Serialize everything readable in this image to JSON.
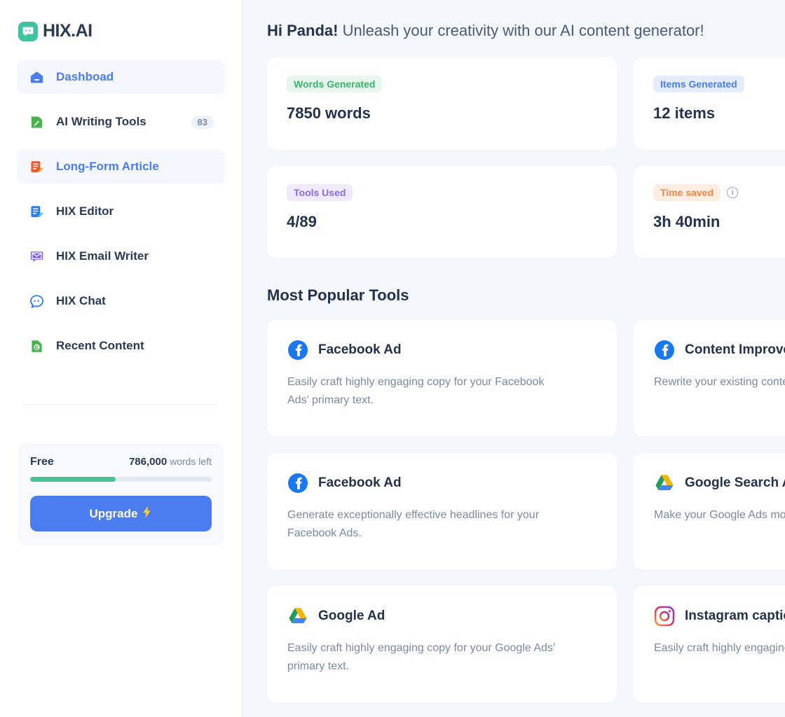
{
  "brand": {
    "name": "HIX.AI",
    "logo_icon": "chat-bubble-icon",
    "logo_color": "#3fc4a0"
  },
  "sidebar": {
    "items": [
      {
        "label": "Dashboad",
        "icon": "home-icon",
        "badge": "",
        "active": true
      },
      {
        "label": "AI Writing Tools",
        "icon": "magic-wand-doc-icon",
        "badge": "83",
        "active": false
      },
      {
        "label": "Long-Form Article",
        "icon": "article-pencil-icon",
        "badge": "",
        "active": true
      },
      {
        "label": "HIX Editor",
        "icon": "editor-doc-icon",
        "badge": "",
        "active": false
      },
      {
        "label": "HIX Email Writer",
        "icon": "email-icon",
        "badge": "",
        "active": false
      },
      {
        "label": "HIX Chat",
        "icon": "chat-icon",
        "badge": "",
        "active": false
      },
      {
        "label": "Recent Content",
        "icon": "recent-file-icon",
        "badge": "",
        "active": false
      }
    ],
    "plan": {
      "name": "Free",
      "quota_number": "786,000",
      "quota_suffix": " words left",
      "progress_percent": 47,
      "progress_color": "#46c494",
      "upgrade_label": "Upgrade",
      "upgrade_icon": "lightning-bolt-icon",
      "upgrade_color": "#4c7df0"
    }
  },
  "main": {
    "greeting_name": "Hi Panda!",
    "greeting_rest": " Unleash your creativity with our AI content generator!",
    "stats": [
      {
        "badge": "Words Generated",
        "badge_color": "#3bb26d",
        "badge_bg": "#e7f7ed",
        "value": "7850 words",
        "has_info": false
      },
      {
        "badge": "Items Generated",
        "badge_color": "#4c7df0",
        "badge_bg": "#e4ecfd",
        "value": "12 items",
        "has_info": false
      },
      {
        "badge": "Tools Used",
        "badge_color": "#8a6ce8",
        "badge_bg": "#efeafc",
        "value": "4/89",
        "has_info": false
      },
      {
        "badge": "Time saved",
        "badge_color": "#f3874a",
        "badge_bg": "#fdeee1",
        "value": "3h 40min",
        "has_info": true,
        "info_icon": "info-circle-icon"
      }
    ],
    "section_title": "Most Popular Tools",
    "tools": [
      {
        "name": "Facebook Ad",
        "icon": "facebook-icon",
        "desc": "Easily craft highly engaging copy for your Facebook Ads’ primary text."
      },
      {
        "name": "Content Improver",
        "icon": "facebook-icon",
        "desc": "Rewrite your existing content to make it more effective."
      },
      {
        "name": "Facebook Ad",
        "icon": "facebook-icon",
        "desc": "Generate exceptionally effective headlines for your Facebook Ads."
      },
      {
        "name": "Google Search Ad",
        "icon": "google-drive-icon",
        "desc": "Make your Google Ads more engaging headlines."
      },
      {
        "name": "Google Ad",
        "icon": "google-drive-icon",
        "desc": "Easily craft highly engaging copy for your Google Ads’ primary text."
      },
      {
        "name": "Instagram caption",
        "icon": "instagram-icon",
        "desc": "Easily craft highly engaging Instagram captions post."
      }
    ]
  }
}
